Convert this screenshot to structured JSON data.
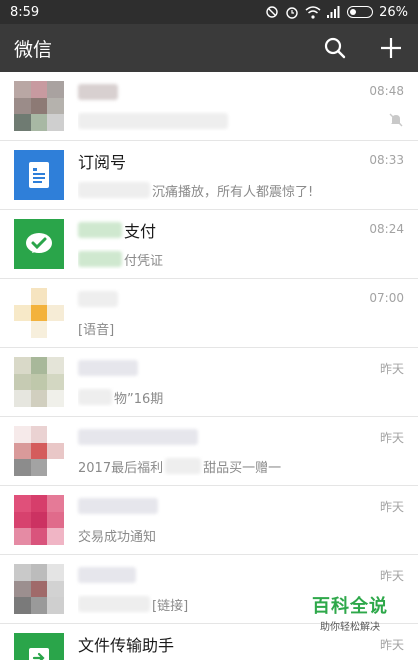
{
  "status": {
    "time": "8:59",
    "battery_text": "26%",
    "battery_level": 0.26
  },
  "app_bar": {
    "title": "微信",
    "search_icon": "search-icon",
    "add_icon": "plus-icon"
  },
  "chats": [
    {
      "name_visible": "",
      "preview": "",
      "time": "08:48",
      "muted": true
    },
    {
      "name_visible": "订阅号",
      "preview": "沉痛播放，所有人都震惊了!",
      "time": "08:33"
    },
    {
      "name_visible": "支付",
      "preview": "付凭证",
      "time": "08:24"
    },
    {
      "name_visible": "",
      "preview": "[语音]",
      "time": "07:00"
    },
    {
      "name_visible": "",
      "preview": "物”16期",
      "time": "昨天"
    },
    {
      "name_visible": "",
      "preview_a": "2017最后福利",
      "preview_b": "甜品买一赠一",
      "time": "昨天"
    },
    {
      "name_visible": "",
      "preview": "交易成功通知",
      "time": "昨天"
    },
    {
      "name_visible": "",
      "preview": "[链接]",
      "time": "昨天"
    },
    {
      "name_visible": "文件传输助手",
      "preview": "",
      "time": "昨天"
    }
  ],
  "watermark": {
    "title": "百科全说",
    "subtitle": "助你轻松解决"
  },
  "colors": {
    "status_bar": "#2e2e2e",
    "app_bar": "#3a3a3a",
    "subscription_blue": "#2f7fd9",
    "wechat_pay_green": "#2aa54a",
    "file_transfer_green": "#2aa54a",
    "watermark_green": "#2ea84a"
  }
}
